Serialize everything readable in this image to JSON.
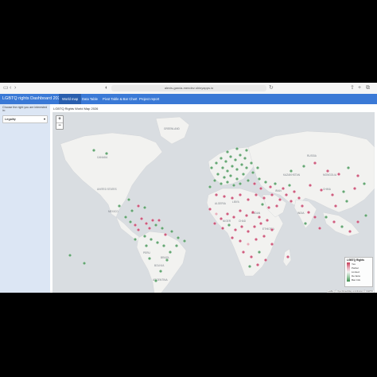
{
  "browser": {
    "url": "alexis-garcia-mendez.shinyapps.io"
  },
  "app": {
    "title": "LGBTQ rights Dashboard 2025"
  },
  "tabs": [
    {
      "label": "World map",
      "active": true
    },
    {
      "label": "Data Table",
      "active": false
    },
    {
      "label": "Pivot Table & Bar Chart",
      "active": false
    },
    {
      "label": "Project report",
      "active": false
    }
  ],
  "sidebar": {
    "prompt": "Choose the right you are interested in:",
    "selected": "Legality"
  },
  "map": {
    "title": "LGBTQ Rights World Map 2026",
    "zoom_in": "+",
    "zoom_out": "−",
    "attribution": "Leaflet | © OpenStreetMap contributors © CARTO",
    "legend": {
      "title": "LGBTQ Rights",
      "items": [
        "Yes",
        "Partial",
        "Limited",
        "De facto",
        "Ban Info"
      ]
    },
    "labels": [
      "CANADA",
      "UNITED STATES",
      "MEXICO",
      "BRAZIL",
      "PERU",
      "BOLIVIA",
      "ARGENTINA",
      "RUSSIA",
      "CHINA",
      "INDIA",
      "ALGERIA",
      "LIBYA",
      "NIGER",
      "CHAD",
      "SUDAN",
      "ETHIOPIA",
      "KAZAKHSTAN",
      "MONGOLIA",
      "IRAN",
      "GREENLAND"
    ],
    "colors": {
      "green": "#4d9a5e",
      "red": "#c9446b",
      "pink": "#e6a3b2"
    }
  }
}
